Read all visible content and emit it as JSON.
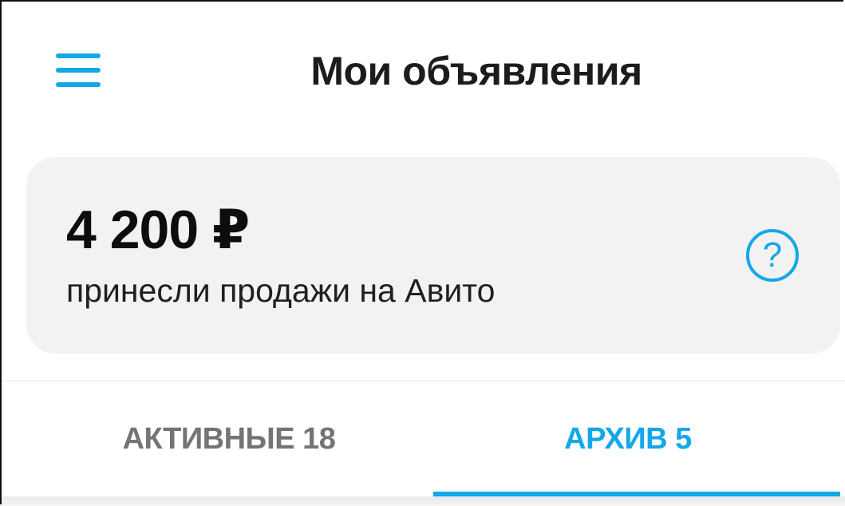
{
  "header": {
    "title": "Мои объявления",
    "menu_icon": "hamburger-menu-icon"
  },
  "earnings": {
    "amount": "4 200 ₽",
    "caption": "принесли продажи на Авито",
    "help_icon": "question-circle-icon",
    "help_symbol": "?"
  },
  "tabs": [
    {
      "label": "АКТИВНЫЕ 18",
      "selected": false
    },
    {
      "label": "АРХИВ 5",
      "selected": true
    }
  ],
  "colors": {
    "accent": "#13a8e8",
    "text": "#1c1c1c",
    "inactive_tab": "#747474",
    "card_bg": "#f2f2f2"
  }
}
